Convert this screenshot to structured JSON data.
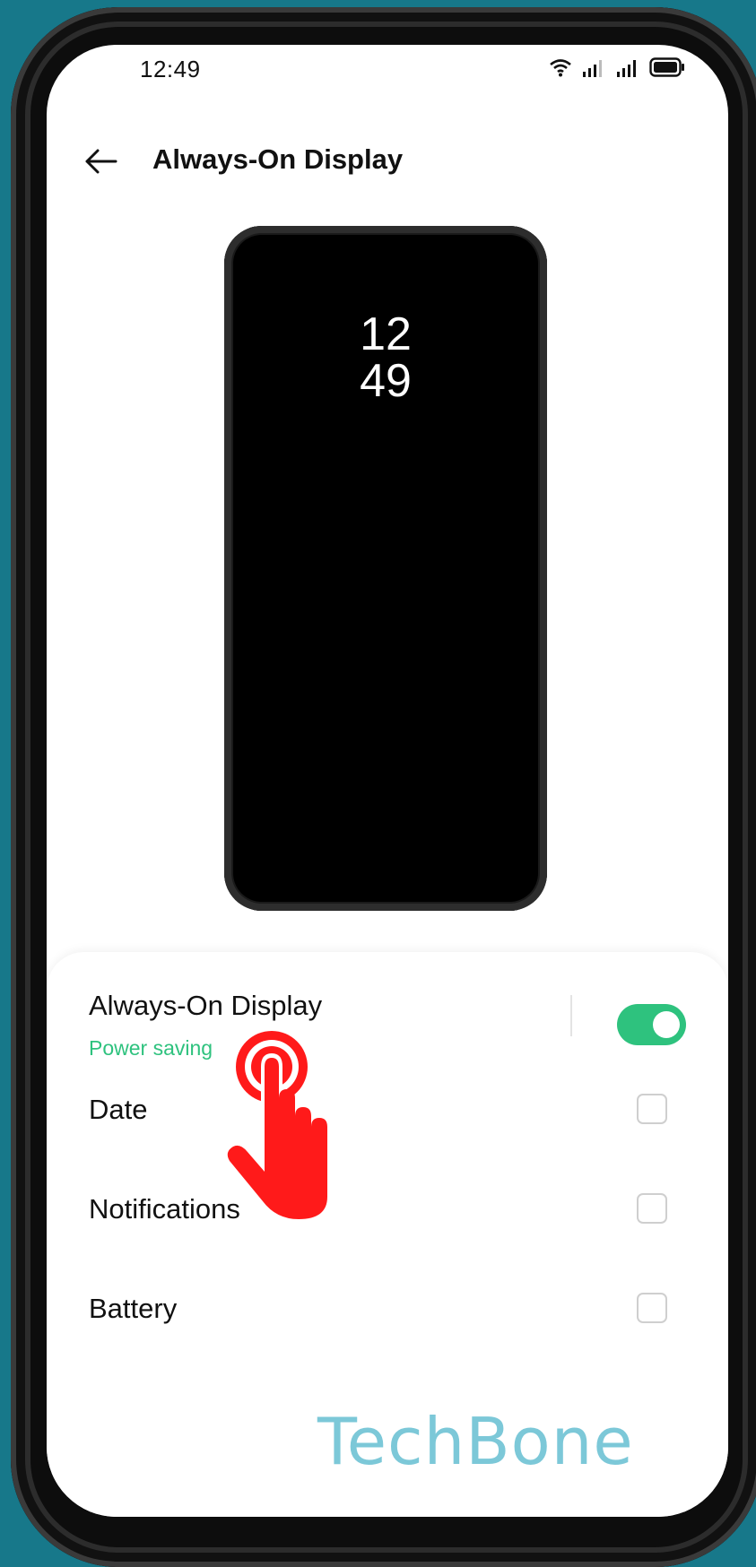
{
  "status_bar": {
    "time": "12:49",
    "icons": [
      "wifi-icon",
      "signal-icon",
      "signal-icon",
      "battery-icon"
    ]
  },
  "header": {
    "back_icon": "arrow-left-icon",
    "title": "Always-On Display"
  },
  "preview": {
    "clock_hour": "12",
    "clock_minute": "49"
  },
  "settings": {
    "aod": {
      "label": "Always-On Display",
      "subtitle": "Power saving",
      "enabled": true
    },
    "date": {
      "label": "Date",
      "checked": false
    },
    "notifications": {
      "label": "Notifications",
      "checked": false
    },
    "battery": {
      "label": "Battery",
      "checked": false
    }
  },
  "overlay": {
    "tap_hint_icon": "hand-tap-icon",
    "watermark": "TechBone"
  },
  "colors": {
    "accent": "#2ec27e",
    "background": "#17788a",
    "tap_hint": "#ff1a1a",
    "watermark": "#7cc8d8"
  }
}
